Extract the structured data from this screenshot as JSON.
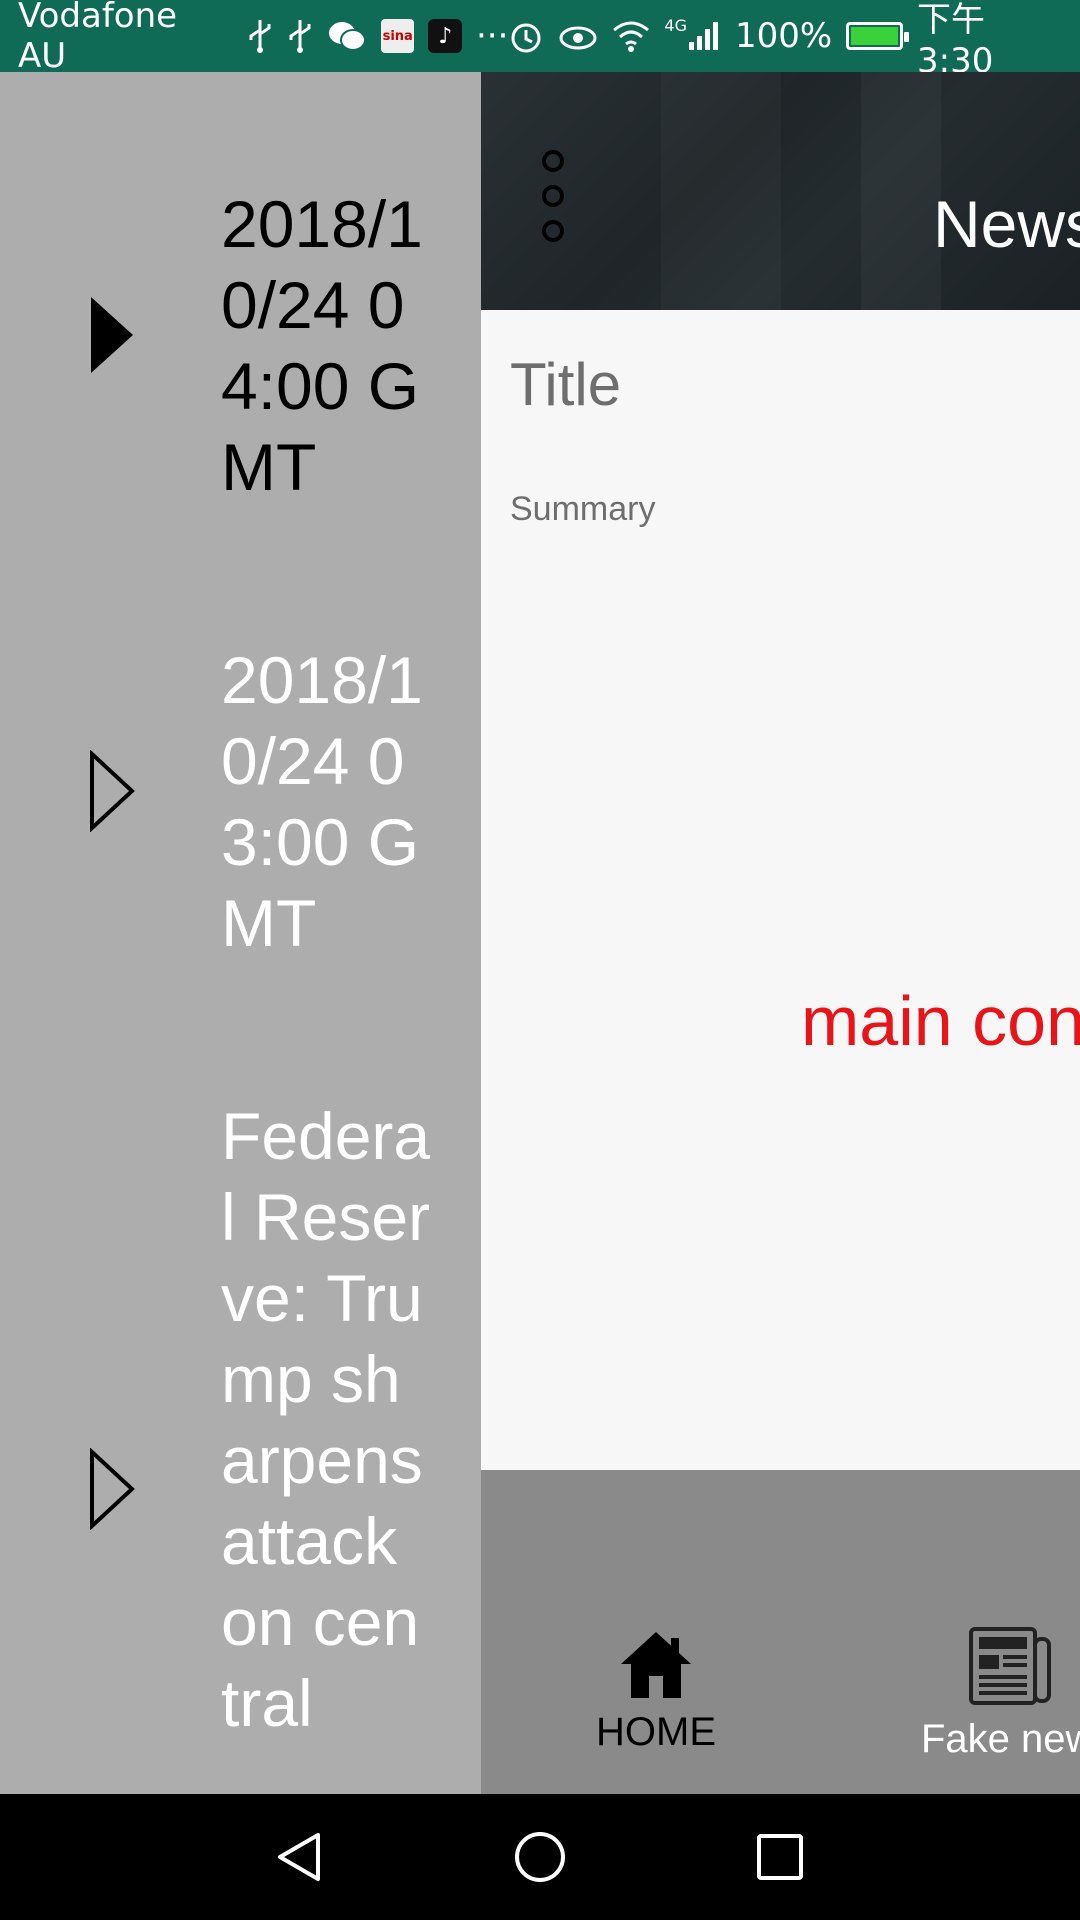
{
  "status_bar": {
    "carrier": "Vodafone AU",
    "sina_label": "sina",
    "battery": "100%",
    "time": "下午3:30",
    "network": "4G",
    "colors": {
      "background": "#0f6b55",
      "battery_fill": "#3ad13a"
    }
  },
  "drawer": {
    "items": [
      {
        "label": "2018/10/24 04:00 GMT",
        "selected": true
      },
      {
        "label": "2018/10/24 03:00 GMT",
        "selected": false
      },
      {
        "label": "Federal Reserve: Trump sharpens attack on central",
        "selected": false
      }
    ],
    "background": "#adadad"
  },
  "app_bar": {
    "title": "News"
  },
  "card": {
    "title": "Title",
    "summary": "Summary",
    "main_content": "main content",
    "main_content_color": "#e8141a"
  },
  "bottom_nav": {
    "items": [
      {
        "label": "HOME",
        "icon": "home-icon",
        "active": true
      },
      {
        "label": "Fake news",
        "icon": "newspaper-icon",
        "active": false
      }
    ]
  },
  "system_nav": {
    "buttons": [
      "back-icon",
      "home-circle-icon",
      "recents-icon"
    ]
  }
}
